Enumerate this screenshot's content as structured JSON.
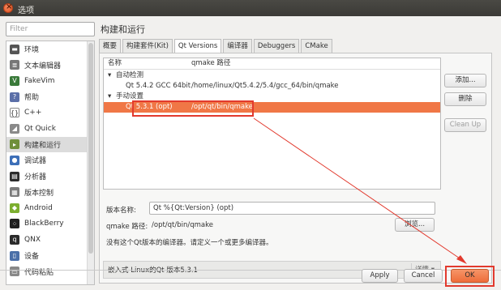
{
  "window": {
    "title": "选项"
  },
  "sidebar": {
    "filter_placeholder": "Filter",
    "items": [
      {
        "label": "环境",
        "icon": "monitor-icon",
        "color": "#555555"
      },
      {
        "label": "文本编辑器",
        "icon": "text-editor-icon",
        "color": "#777777"
      },
      {
        "label": "FakeVim",
        "icon": "fakevim-icon",
        "color": "#3a7a3a"
      },
      {
        "label": "帮助",
        "icon": "help-icon",
        "color": "#5b6fa8"
      },
      {
        "label": "C++",
        "icon": "cpp-braces-icon",
        "color": "#ffffff"
      },
      {
        "label": "Qt Quick",
        "icon": "qtquick-icon",
        "color": "#8a8a8a"
      },
      {
        "label": "构建和运行",
        "icon": "build-run-icon",
        "color": "#6f8f3a"
      },
      {
        "label": "调试器",
        "icon": "debugger-icon",
        "color": "#3d6fb8"
      },
      {
        "label": "分析器",
        "icon": "analyzer-icon",
        "color": "#2b2b2b"
      },
      {
        "label": "版本控制",
        "icon": "version-control-icon",
        "color": "#7a7a7a"
      },
      {
        "label": "Android",
        "icon": "android-icon",
        "color": "#7cae2f"
      },
      {
        "label": "BlackBerry",
        "icon": "blackberry-icon",
        "color": "#1f1f1f"
      },
      {
        "label": "QNX",
        "icon": "qnx-icon",
        "color": "#2b2b2b"
      },
      {
        "label": "设备",
        "icon": "device-icon",
        "color": "#4a6fa8"
      },
      {
        "label": "代码粘贴",
        "icon": "code-paste-icon",
        "color": "#888888"
      }
    ]
  },
  "main": {
    "section_title": "构建和运行",
    "tabs": [
      "概要",
      "构建套件(Kit)",
      "Qt Versions",
      "编译器",
      "Debuggers",
      "CMake"
    ],
    "tree": {
      "headers": {
        "name": "名称",
        "path": "qmake 路径"
      },
      "groups": [
        {
          "label": "自动检测",
          "items": [
            {
              "name": "Qt 5.4.2 GCC 64bit",
              "path": "/home/linux/Qt5.4.2/5.4/gcc_64/bin/qmake"
            }
          ]
        },
        {
          "label": "手动设置",
          "items": [
            {
              "name": "Qt 5.3.1 (opt)",
              "path": "/opt/qt/bin/qmake"
            }
          ]
        }
      ]
    },
    "side_buttons": {
      "add": "添加...",
      "remove": "删除",
      "cleanup": "Clean Up"
    },
    "details": {
      "version_name_label": "版本名称:",
      "version_name_value": "Qt %{Qt:Version} (opt)",
      "qmake_path_label": "qmake 路径:",
      "qmake_path_value": "/opt/qt/bin/qmake",
      "browse": "浏览...",
      "warning": "没有这个Qt版本的编译器。请定义一个或更多编译器。"
    },
    "embedded_label": "嵌入式 Linux的Qt 版本5.3.1",
    "details_toggle": "详情 ▾"
  },
  "footer": {
    "apply": "Apply",
    "cancel": "Cancel",
    "ok": "OK"
  },
  "accent_color": "#f07746",
  "annotation_color": "#e23a2e"
}
